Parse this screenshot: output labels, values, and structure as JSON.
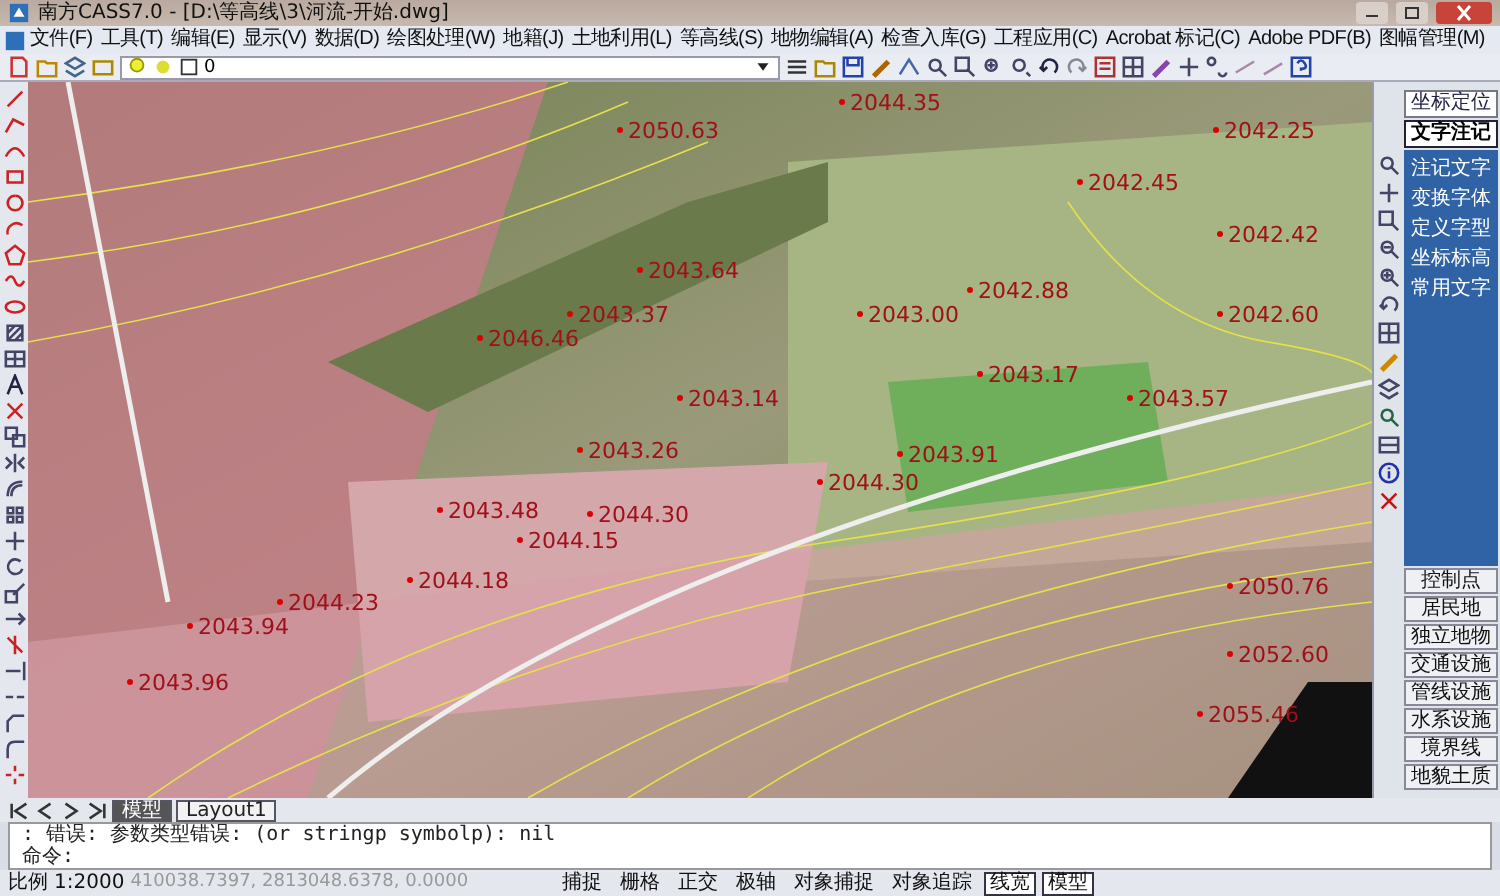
{
  "window": {
    "title": "南方CASS7.0 - [D:\\等高线\\3\\河流-开始.dwg]"
  },
  "menu": [
    "文件(F)",
    "工具(T)",
    "编辑(E)",
    "显示(V)",
    "数据(D)",
    "绘图处理(W)",
    "地籍(J)",
    "土地利用(L)",
    "等高线(S)",
    "地物编辑(A)",
    "检查入库(G)",
    "工程应用(C)",
    "Acrobat 标记(C)",
    "Adobe PDF(B)",
    "图幅管理(M)"
  ],
  "toolbar": {
    "layer": "0"
  },
  "map": {
    "labels": [
      "2044.35",
      "2050.63",
      "2042.25",
      "2042.45",
      "2042.42",
      "2043.64",
      "2042.88",
      "2043.37",
      "2043.00",
      "2042.60",
      "2046.46",
      "2043.17",
      "2043.14",
      "2043.57",
      "2043.26",
      "2043.91",
      "2044.30",
      "2043.48",
      "2044.30",
      "2044.15",
      "2044.18",
      "2044.23",
      "2043.94",
      "2043.96",
      "2050.76",
      "2052.60",
      "2055.46"
    ]
  },
  "right_panel": {
    "top_buttons": [
      {
        "label": "坐标定位",
        "selected": false
      },
      {
        "label": "文字注记",
        "selected": true
      }
    ],
    "list": [
      "注记文字",
      "变换字体",
      "定义字型",
      "坐标标高",
      "常用文字"
    ],
    "categories": [
      "控制点",
      "居民地",
      "独立地物",
      "交通设施",
      "管线设施",
      "水系设施",
      "境界线",
      "地貌土质"
    ]
  },
  "layout_tabs": [
    {
      "label": "模型",
      "selected": true
    },
    {
      "label": "Layout1",
      "selected": false
    }
  ],
  "command": {
    "lines": [
      ": 错误: 参数类型错误: (or stringp symbolp): nil",
      "命令:"
    ]
  },
  "status_bar": {
    "scale_label": "比例",
    "scale": "1:2000",
    "coords": "410038.7397, 2813048.6378, 0.0000",
    "toggles": [
      {
        "label": "捕捉",
        "pressed": false
      },
      {
        "label": "栅格",
        "pressed": false
      },
      {
        "label": "正交",
        "pressed": false
      },
      {
        "label": "极轴",
        "pressed": false
      },
      {
        "label": "对象捕捉",
        "pressed": false
      },
      {
        "label": "对象追踪",
        "pressed": false
      },
      {
        "label": "线宽",
        "pressed": true
      },
      {
        "label": "模型",
        "pressed": true
      }
    ]
  }
}
